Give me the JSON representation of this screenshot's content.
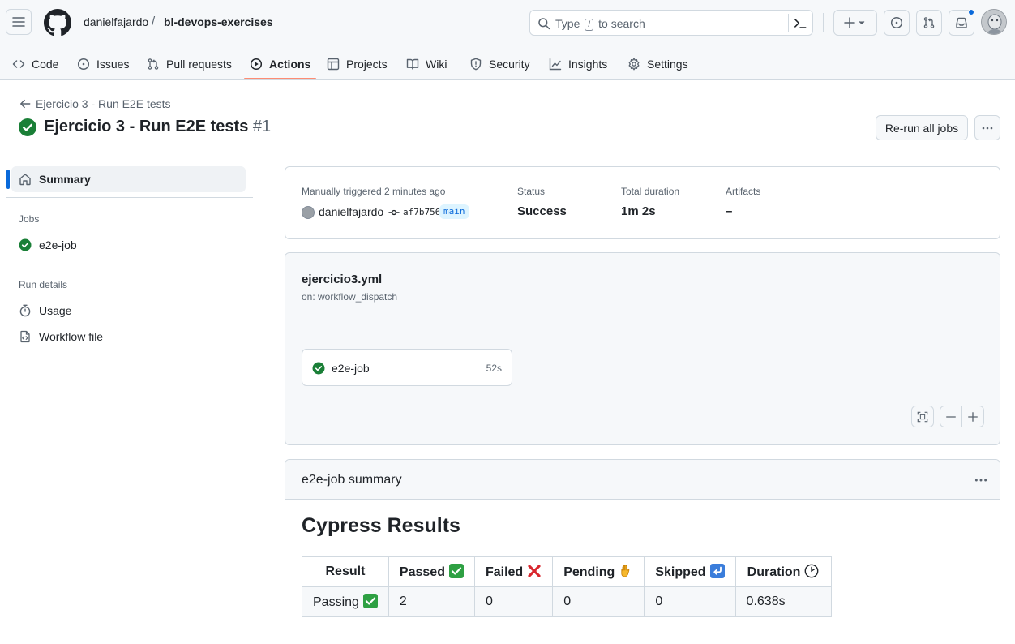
{
  "repo": {
    "owner": "danielfajardo",
    "separator": "/",
    "name": "bl-devops-exercises"
  },
  "search": {
    "prefix": "Type",
    "key": "/",
    "suffix": "to search"
  },
  "tabs": [
    {
      "label": "Code",
      "icon": "code-icon"
    },
    {
      "label": "Issues",
      "icon": "issue-opened-icon"
    },
    {
      "label": "Pull requests",
      "icon": "git-pull-request-icon"
    },
    {
      "label": "Actions",
      "icon": "play-icon",
      "active": true
    },
    {
      "label": "Projects",
      "icon": "table-icon"
    },
    {
      "label": "Wiki",
      "icon": "book-icon"
    },
    {
      "label": "Security",
      "icon": "shield-icon"
    },
    {
      "label": "Insights",
      "icon": "graph-icon"
    },
    {
      "label": "Settings",
      "icon": "gear-icon"
    }
  ],
  "run": {
    "back_label": "Ejercicio 3 - Run E2E tests",
    "title": "Ejercicio 3 - Run E2E tests",
    "number": "#1",
    "rerun_label": "Re-run all jobs"
  },
  "sidebar": {
    "summary_label": "Summary",
    "jobs_heading": "Jobs",
    "jobs": [
      {
        "label": "e2e-job"
      }
    ],
    "run_details_heading": "Run details",
    "usage_label": "Usage",
    "workflow_file_label": "Workflow file"
  },
  "meta": {
    "trigger_label": "Manually triggered 2 minutes ago",
    "user": "danielfajardo",
    "commit": "af7b756",
    "branch": "main",
    "status_label": "Status",
    "status_value": "Success",
    "duration_label": "Total duration",
    "duration_value": "1m 2s",
    "artifacts_label": "Artifacts",
    "artifacts_value": "–"
  },
  "graph": {
    "workflow_file": "ejercicio3.yml",
    "trigger": "on: workflow_dispatch",
    "job": {
      "name": "e2e-job",
      "duration": "52s"
    }
  },
  "job_summary": {
    "title": "e2e-job summary",
    "heading": "Cypress Results",
    "columns": [
      "Result",
      "Passed",
      "Failed",
      "Pending",
      "Skipped",
      "Duration"
    ],
    "row": {
      "result": "Passing",
      "passed": "2",
      "failed": "0",
      "pending": "0",
      "skipped": "0",
      "duration": "0.638s"
    }
  },
  "colors": {
    "success": "#1a7f37",
    "accent": "#0969da",
    "active_tab": "#fd8c73"
  }
}
